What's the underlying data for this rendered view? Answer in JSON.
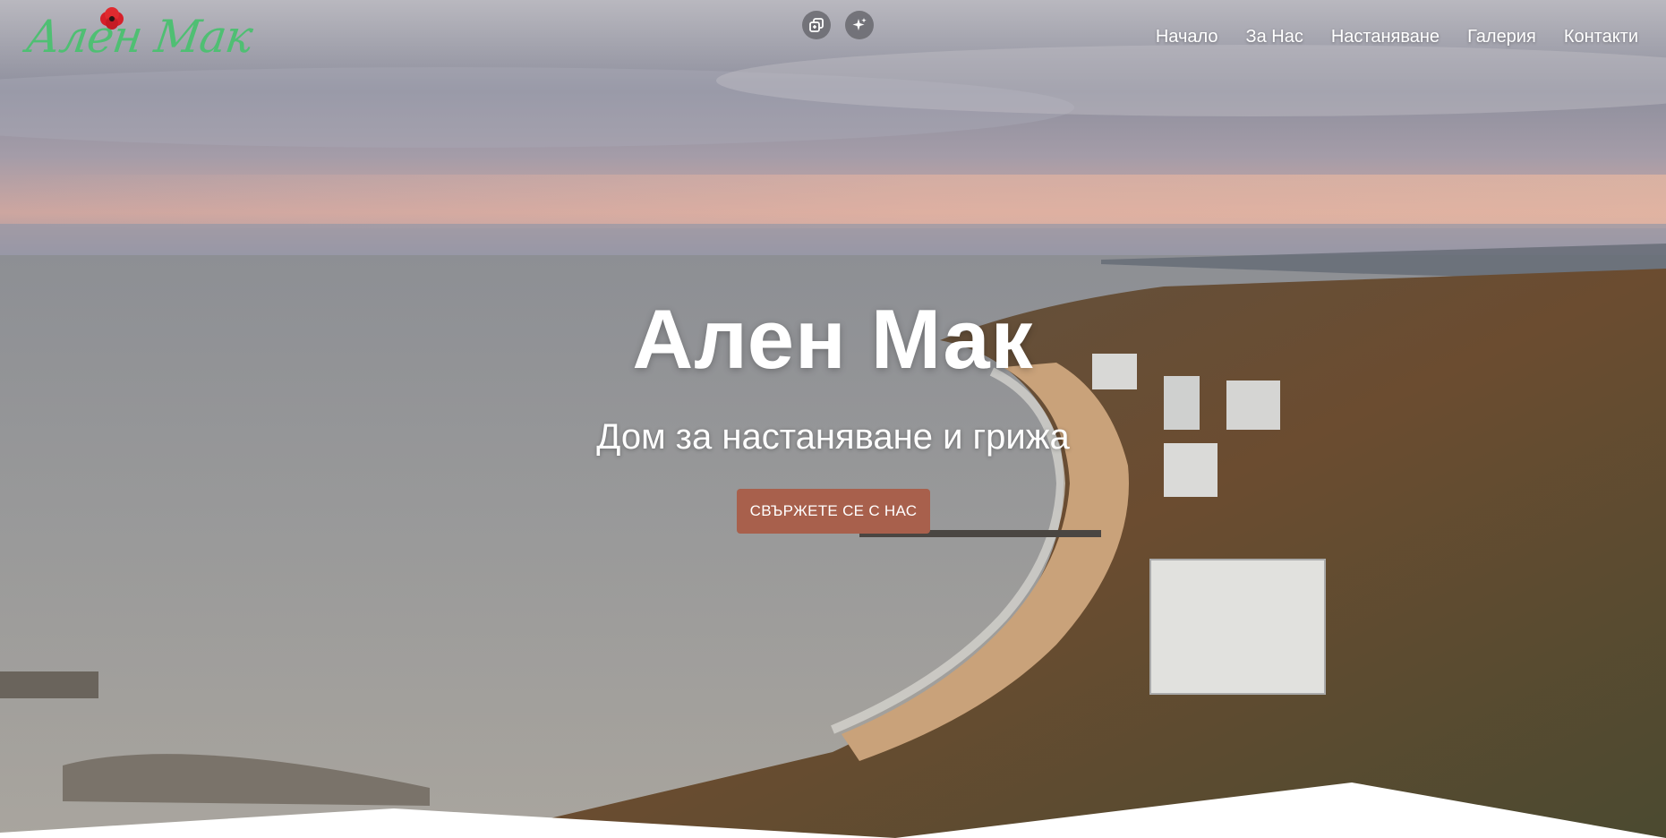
{
  "brand": {
    "logo_text": "Ален Мак"
  },
  "toolbar": {
    "icons": [
      "copy-icon",
      "sparkle-icon"
    ]
  },
  "nav": {
    "items": [
      {
        "label": "Начало"
      },
      {
        "label": "За Нас"
      },
      {
        "label": "Настаняване"
      },
      {
        "label": "Галерия"
      },
      {
        "label": "Контакти"
      }
    ]
  },
  "hero": {
    "title": "Ален Мак",
    "subtitle": "Дом за настаняване и грижа",
    "cta_label": "СВЪРЖЕТЕ СЕ С НАС"
  },
  "colors": {
    "accent": "#a8604c",
    "logo_green": "#4fbf73",
    "logo_red": "#d6202a",
    "nav_text": "#ffffff"
  }
}
